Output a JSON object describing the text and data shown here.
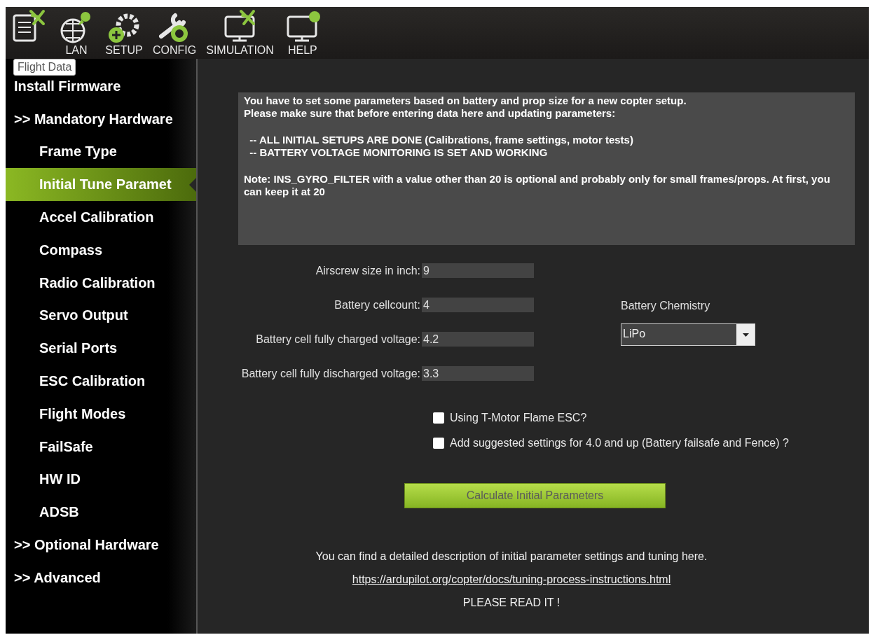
{
  "toolbar": {
    "items": [
      {
        "kind": "data"
      },
      {
        "label": "LAN",
        "kind": "plan"
      },
      {
        "label": "SETUP",
        "kind": "setup"
      },
      {
        "label": "CONFIG",
        "kind": "config"
      },
      {
        "label": "SIMULATION",
        "kind": "simulation"
      },
      {
        "label": "HELP",
        "kind": "help"
      }
    ],
    "tooltip": "Flight Data"
  },
  "sidebar": {
    "items": [
      {
        "label": "Install Firmware",
        "kind": "header",
        "selected": false
      },
      {
        "label": ">> Mandatory Hardware",
        "kind": "header",
        "selected": false
      },
      {
        "label": "Frame Type",
        "kind": "item",
        "selected": false
      },
      {
        "label": "Initial Tune Paramet",
        "kind": "item",
        "selected": true
      },
      {
        "label": "Accel Calibration",
        "kind": "item",
        "selected": false
      },
      {
        "label": "Compass",
        "kind": "item",
        "selected": false
      },
      {
        "label": "Radio Calibration",
        "kind": "item",
        "selected": false
      },
      {
        "label": "Servo Output",
        "kind": "item",
        "selected": false
      },
      {
        "label": "Serial Ports",
        "kind": "item",
        "selected": false
      },
      {
        "label": "ESC Calibration",
        "kind": "item",
        "selected": false
      },
      {
        "label": "Flight Modes",
        "kind": "item",
        "selected": false
      },
      {
        "label": "FailSafe",
        "kind": "item",
        "selected": false
      },
      {
        "label": "HW ID",
        "kind": "item",
        "selected": false
      },
      {
        "label": "ADSB",
        "kind": "item",
        "selected": false
      },
      {
        "label": ">> Optional Hardware",
        "kind": "header",
        "selected": false
      },
      {
        "label": ">> Advanced",
        "kind": "header",
        "selected": false
      }
    ]
  },
  "info": {
    "paragraphs": [
      "You have to set some parameters based on battery and prop size for a new copter setup.\nPlease make sure that before entering data here and updating parameters:",
      "  -- ALL INITIAL SETUPS ARE DONE (Calibrations, frame settings, motor tests)\n  -- BATTERY VOLTAGE MONITORING IS SET AND WORKING",
      "Note: INS_GYRO_FILTER with a value other than 20 is optional and probably only for small frames/props. At first, you can keep it at 20"
    ]
  },
  "fields": [
    {
      "label": "Airscrew size in inch:",
      "value": "9"
    },
    {
      "label": "Battery cellcount:",
      "value": "4"
    },
    {
      "label": "Battery cell fully charged voltage:",
      "value": "4.2"
    },
    {
      "label": "Battery cell fully discharged voltage:",
      "value": "3.3"
    }
  ],
  "chemistry": {
    "label": "Battery Chemistry",
    "value": "LiPo"
  },
  "options": [
    {
      "label": "Using T-Motor Flame ESC?",
      "checked": false
    },
    {
      "label": "Add suggested settings for 4.0 and up (Battery failsafe and Fence) ?",
      "checked": false
    }
  ],
  "calculate_button": "Calculate Initial Parameters",
  "footer": {
    "note": "You can find a detailed description of initial parameter settings and tuning here.",
    "link": "https://ardupilot.org/copter/docs/tuning-process-instructions.html",
    "warning": "PLEASE READ IT !"
  }
}
